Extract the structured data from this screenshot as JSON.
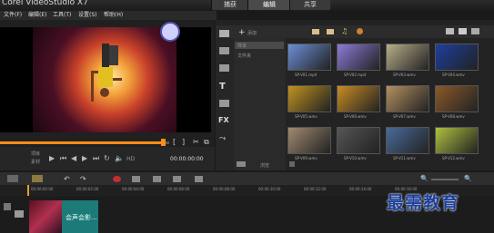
{
  "app": {
    "title": "Corel VideoStudio X7"
  },
  "mode_tabs": [
    "捕获",
    "编辑",
    "共享"
  ],
  "menu": [
    "文件(F)",
    "编辑(E)",
    "工具(T)",
    "设置(S)",
    "帮助(H)"
  ],
  "player": {
    "mode_project": "项目",
    "mode_clip": "素材",
    "hd_label": "HD",
    "timecode": "00:00:00:00",
    "progress": 0.96
  },
  "library": {
    "add_label": "添加",
    "folders": [
      "样本",
      "文件夹"
    ],
    "browse_label": "浏览",
    "thumbnails": [
      {
        "label": "SP-V01.mp4",
        "color": "#6c8fd6"
      },
      {
        "label": "SP-V02.mp4",
        "color": "#8d7ad8"
      },
      {
        "label": "SP-V03.wmv",
        "color": "#b9ae8a"
      },
      {
        "label": "SP-V04.wmv",
        "color": "#1d3f9e"
      },
      {
        "label": "SP-V05.wmv",
        "color": "#c09320"
      },
      {
        "label": "SP-V06.wmv",
        "color": "#c98c24"
      },
      {
        "label": "SP-V07.wmv",
        "color": "#b49060"
      },
      {
        "label": "SP-V08.wmv",
        "color": "#8a5a2a"
      },
      {
        "label": "SP-V09.wmv",
        "color": "#a08a70"
      },
      {
        "label": "SP-V10.wmv",
        "color": "#555555"
      },
      {
        "label": "SP-V11.wmv",
        "color": "#4a6a9a"
      },
      {
        "label": "SP-V12.wmv",
        "color": "#b0c040"
      }
    ]
  },
  "timeline": {
    "ruler": [
      "00:00:00:00",
      "00:00:02:00",
      "00:00:04:00",
      "00:00:06:00",
      "00:00:08:00",
      "00:00:10:00",
      "00:00:12:00",
      "00:00:14:00",
      "00:00:16:00"
    ],
    "clip_text": "会声会影..."
  },
  "watermark": "最需教育"
}
